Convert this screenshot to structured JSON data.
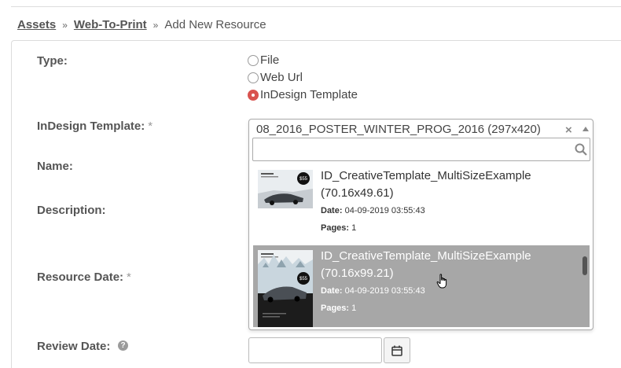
{
  "breadcrumb": {
    "items": [
      "Assets",
      "Web-To-Print"
    ],
    "separator": "»",
    "current": "Add New Resource"
  },
  "form": {
    "type_label": "Type:",
    "type_options": [
      "File",
      "Web Url",
      "InDesign Template"
    ],
    "type_selected": "InDesign Template",
    "indesign_label": "InDesign Template:",
    "name_label": "Name:",
    "description_label": "Description:",
    "resource_date_label": "Resource Date:",
    "review_date_label": "Review Date:",
    "required_marker": "*",
    "help_glyph": "?",
    "review_date_value": ""
  },
  "dropdown": {
    "selected_value": "08_2016_POSTER_WINTER_PROG_2016 (297x420)",
    "clear_glyph": "×",
    "search_value": "",
    "date_label": "Date:",
    "pages_label": "Pages:",
    "options": [
      {
        "name": "ID_CreativeTemplate_MultiSizeExample (70.16x49.61)",
        "date": "04-09-2019 03:55:43",
        "pages": "1",
        "thumb_price": "$55",
        "highlighted": false
      },
      {
        "name": "ID_CreativeTemplate_MultiSizeExample (70.16x99.21)",
        "date": "04-09-2019 03:55:43",
        "pages": "1",
        "thumb_price": "$55",
        "highlighted": true
      }
    ]
  },
  "colors": {
    "radio_checked": "#d9534f",
    "highlight_bg": "#a7a7a7",
    "label_text": "#555555"
  },
  "icons": {
    "search": "search-icon",
    "calendar": "calendar-icon",
    "help": "help-icon",
    "cursor": "hand-cursor-icon"
  }
}
